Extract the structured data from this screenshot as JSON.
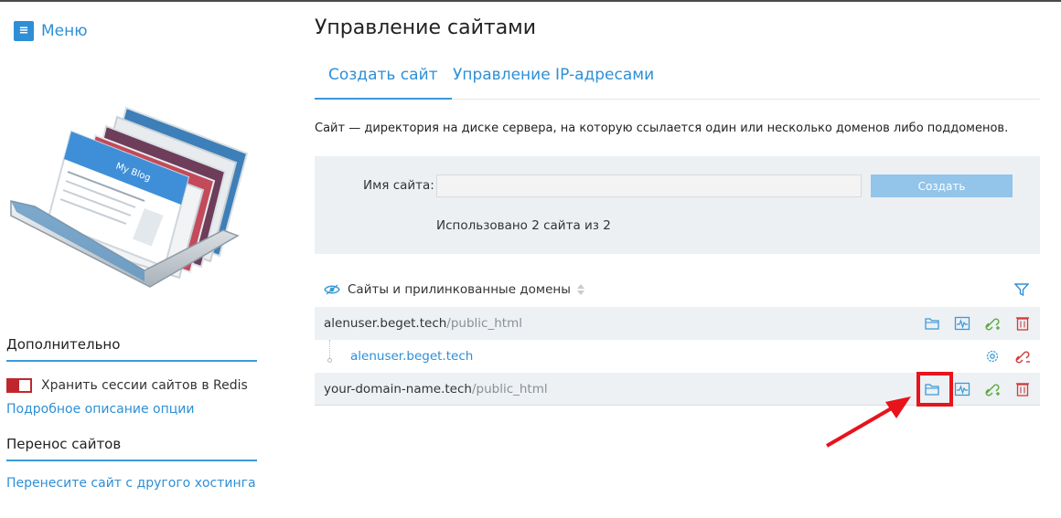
{
  "menu": {
    "icon": "hamburger-icon",
    "label": "Меню"
  },
  "sidebar": {
    "extra": {
      "title": "Дополнительно",
      "redis_toggle": {
        "label": "Хранить сессии сайтов в Redis",
        "state": "off"
      },
      "details_link": "Подробное описание опции"
    },
    "transfer": {
      "title": "Перенос сайтов",
      "link": "Перенесите сайт с другого хостинга"
    },
    "illustration": "browser-windows-stack-illustration",
    "illustration_text": "My Blog"
  },
  "page": {
    "title": "Управление сайтами",
    "tabs": [
      {
        "label": "Создать сайт",
        "active": true
      },
      {
        "label": "Управление IP-адресами",
        "active": false
      }
    ],
    "description": "Сайт — директория на диске сервера, на которую ссылается один или несколько доменов либо поддоменов."
  },
  "create_form": {
    "name_label": "Имя сайта:",
    "name_value": "",
    "create_button": "Создать",
    "usage_text": "Использовано 2 сайта из 2"
  },
  "list": {
    "header": "Сайты и прилинкованные домены",
    "sites": [
      {
        "name": "alenuser.beget.tech",
        "path": "/public_html",
        "domains": [
          "alenuser.beget.tech"
        ]
      },
      {
        "name": "your-domain-name.tech",
        "path": "/public_html",
        "domains": []
      }
    ]
  },
  "colors": {
    "accent": "#2e8fd6",
    "panel": "#edf0f3",
    "button": "#93c4ea",
    "danger": "#d03a3a",
    "success": "#5aa83c",
    "highlight": "#e8131b"
  }
}
